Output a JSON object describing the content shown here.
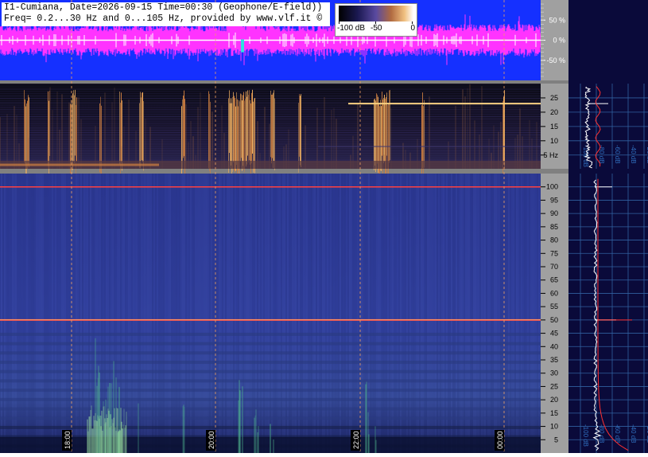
{
  "header": {
    "line1": "I1-Cumiana, Date=2026-09-15 Time=00:30 (Geophone/E-field))",
    "line2": "Freq= 0.2...30 Hz and 0...105 Hz, provided by www.vlf.it ©"
  },
  "colorbar": {
    "ticks": [
      "-100 dB",
      "-50",
      "0"
    ]
  },
  "chart_data": [
    {
      "type": "line",
      "panel": "waveform",
      "ylabel_ticks": [
        "50 %",
        "0 %",
        "-50 %"
      ],
      "yticks": [
        50,
        0,
        -50
      ],
      "ylim": [
        -100,
        100
      ],
      "series_color": "#ff33ff",
      "background_color": "#1530ff"
    },
    {
      "type": "heatmap",
      "panel": "spectrogram-low",
      "yticks": [
        5,
        10,
        15,
        20,
        25
      ],
      "ytick_labels": [
        "5 Hz",
        "10",
        "15",
        "20",
        "25"
      ],
      "ylim": [
        0.2,
        30
      ],
      "side_xtick_labels": [
        "-100 dB",
        "-80 dB",
        "-60 dB",
        "-40 dB",
        "-20 dB"
      ],
      "colors": [
        "#000000",
        "#3a2c60",
        "#a06030",
        "#f8c070"
      ]
    },
    {
      "type": "heatmap",
      "panel": "spectrogram-high",
      "yticks": [
        5,
        10,
        15,
        20,
        25,
        30,
        35,
        40,
        45,
        50,
        55,
        60,
        65,
        70,
        75,
        80,
        85,
        90,
        95,
        100
      ],
      "ylim": [
        0,
        105
      ],
      "side_xtick_labels": [
        "-100 dB",
        "-80 dB",
        "-60 dB",
        "-40 dB",
        "-20 dB"
      ],
      "colors": [
        "#1a2066",
        "#3a4aa8",
        "#40a080",
        "#f8f8f8"
      ]
    }
  ],
  "time_axis": [
    "18:00",
    "20:00",
    "22:00",
    "00:00"
  ]
}
